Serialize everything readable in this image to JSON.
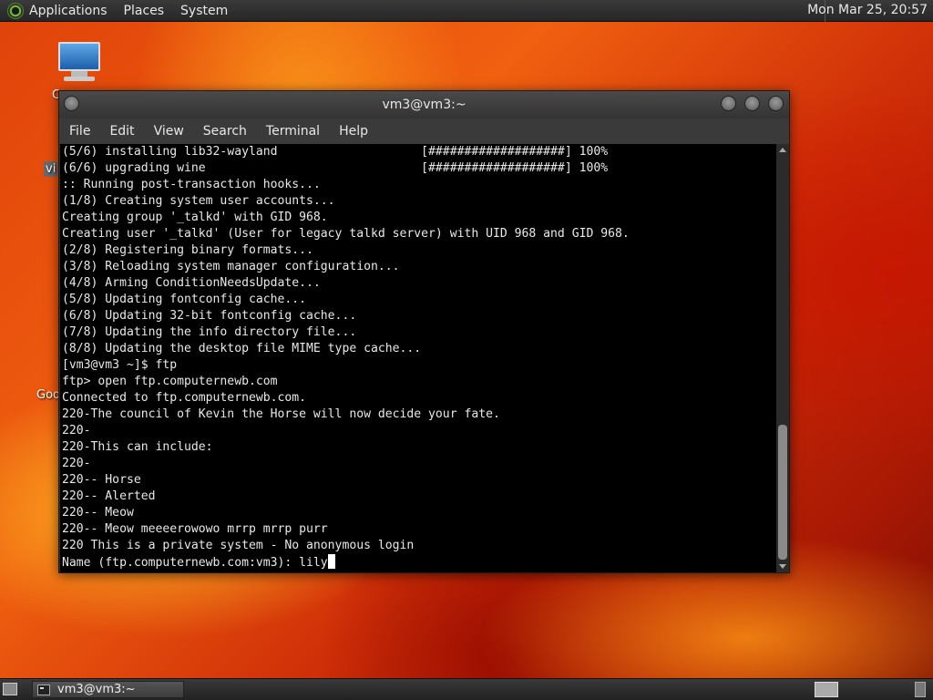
{
  "top_panel": {
    "menus": [
      "Applications",
      "Places",
      "System"
    ],
    "clock": "Mon Mar 25, 20:57",
    "logo_icon": "gnome-foot-icon"
  },
  "desktop": {
    "icon_label_fragments": [
      "C",
      "vi",
      "Goo"
    ]
  },
  "window": {
    "title": "vm3@vm3:~",
    "menus": [
      "File",
      "Edit",
      "View",
      "Search",
      "Terminal",
      "Help"
    ]
  },
  "terminal": {
    "lines": [
      "(5/6) installing lib32-wayland                    [###################] 100%",
      "(6/6) upgrading wine                              [###################] 100%",
      ":: Running post-transaction hooks...",
      "(1/8) Creating system user accounts...",
      "Creating group '_talkd' with GID 968.",
      "Creating user '_talkd' (User for legacy talkd server) with UID 968 and GID 968.",
      "(2/8) Registering binary formats...",
      "(3/8) Reloading system manager configuration...",
      "(4/8) Arming ConditionNeedsUpdate...",
      "(5/8) Updating fontconfig cache...",
      "(6/8) Updating 32-bit fontconfig cache...",
      "(7/8) Updating the info directory file...",
      "(8/8) Updating the desktop file MIME type cache...",
      "[vm3@vm3 ~]$ ftp",
      "ftp> open ftp.computernewb.com",
      "Connected to ftp.computernewb.com.",
      "220-The council of Kevin the Horse will now decide your fate.",
      "220-",
      "220-This can include:",
      "220-",
      "220-- Horse",
      "220-- Alerted",
      "220-- Meow",
      "220-- Meow meeeerowowo mrrp mrrp purr",
      "220 This is a private system - No anonymous login"
    ],
    "prompt": "Name (ftp.computernewb.com:vm3): ",
    "input_value": "lily"
  },
  "taskbar": {
    "task_label": "vm3@vm3:~"
  },
  "colors": {
    "terminal_bg": "#000000",
    "terminal_fg": "#e8e8e8",
    "panel_bg": "#2e2e2e"
  }
}
